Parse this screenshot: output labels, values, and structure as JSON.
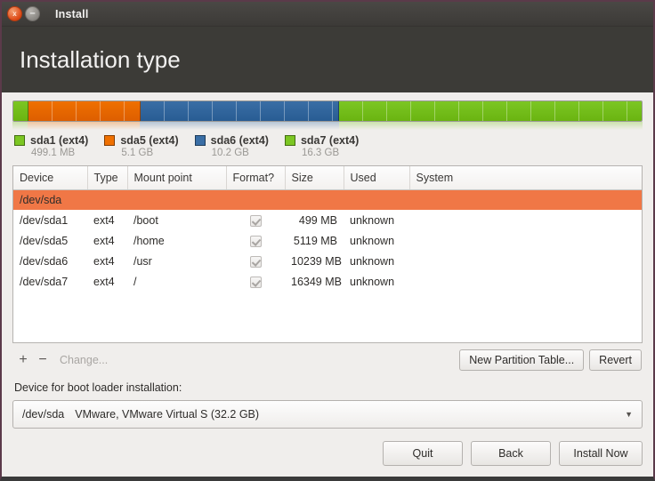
{
  "window": {
    "title": "Install",
    "close_icon": "close-icon",
    "minimize_icon": "minimize-icon",
    "close_glyph": "x",
    "minimize_glyph": "–"
  },
  "header": {
    "page_title": "Installation type"
  },
  "partition_bar": {
    "segments": [
      {
        "name": "sda1",
        "color": "#7cc623",
        "percent": 2.4
      },
      {
        "name": "sda5",
        "color": "#ef7000",
        "percent": 17.8
      },
      {
        "name": "sda6",
        "color": "#3a6ea5",
        "percent": 31.6
      },
      {
        "name": "sda7",
        "color": "#7cc623",
        "percent": 48.2
      }
    ]
  },
  "legend": {
    "items": [
      {
        "label": "sda1 (ext4)",
        "size": "499.1 MB",
        "color": "#7cc623"
      },
      {
        "label": "sda5 (ext4)",
        "size": "5.1 GB",
        "color": "#ef7000"
      },
      {
        "label": "sda6 (ext4)",
        "size": "10.2 GB",
        "color": "#3a6ea5"
      },
      {
        "label": "sda7 (ext4)",
        "size": "16.3 GB",
        "color": "#7cc623"
      }
    ]
  },
  "table": {
    "columns": [
      "Device",
      "Type",
      "Mount point",
      "Format?",
      "Size",
      "Used",
      "System"
    ],
    "rows": [
      {
        "selected": true,
        "device": "/dev/sda",
        "type": "",
        "mount": "",
        "format": false,
        "size": "",
        "used": "",
        "system": ""
      },
      {
        "selected": false,
        "device": "/dev/sda1",
        "type": "ext4",
        "mount": "/boot",
        "format": true,
        "size": "499 MB",
        "used": "unknown",
        "system": ""
      },
      {
        "selected": false,
        "device": "/dev/sda5",
        "type": "ext4",
        "mount": "/home",
        "format": true,
        "size": "5119 MB",
        "used": "unknown",
        "system": ""
      },
      {
        "selected": false,
        "device": "/dev/sda6",
        "type": "ext4",
        "mount": "/usr",
        "format": true,
        "size": "10239 MB",
        "used": "unknown",
        "system": ""
      },
      {
        "selected": false,
        "device": "/dev/sda7",
        "type": "ext4",
        "mount": "/",
        "format": true,
        "size": "16349 MB",
        "used": "unknown",
        "system": ""
      }
    ]
  },
  "toolbar": {
    "add_label": "+",
    "remove_label": "−",
    "change_label": "Change...",
    "new_partition_table_label": "New Partition Table...",
    "revert_label": "Revert"
  },
  "boot_loader": {
    "label": "Device for boot loader installation:",
    "selected_device": "/dev/sda",
    "selected_description": "VMware, VMware Virtual S (32.2 GB)",
    "arrow_glyph": "▼"
  },
  "footer": {
    "quit_label": "Quit",
    "back_label": "Back",
    "install_label": "Install Now"
  },
  "colors": {
    "accent_orange": "#f07746",
    "title_bar": "#3c3b37",
    "content_bg": "#f0eeec",
    "selected_row": "#f07746"
  }
}
